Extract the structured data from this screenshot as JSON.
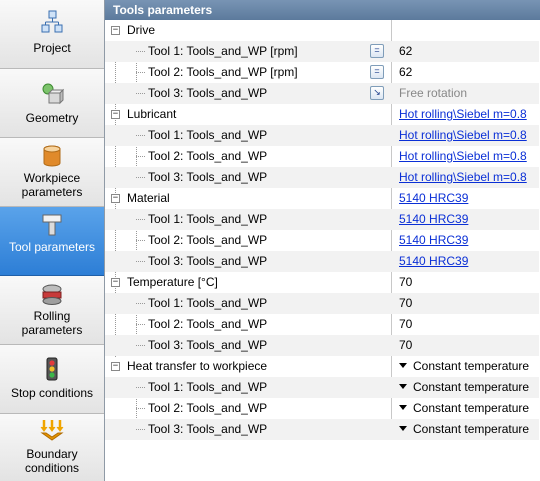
{
  "nav": [
    {
      "label": "Project",
      "icon": "project-icon"
    },
    {
      "label": "Geometry",
      "icon": "geometry-icon"
    },
    {
      "label": "Workpiece parameters",
      "icon": "workpiece-icon"
    },
    {
      "label": "Tool parameters",
      "icon": "tool-icon",
      "active": true
    },
    {
      "label": "Rolling parameters",
      "icon": "rolling-icon"
    },
    {
      "label": "Stop conditions",
      "icon": "traffic-light-icon"
    },
    {
      "label": "Boundary conditions",
      "icon": "boundary-icon"
    }
  ],
  "panel": {
    "title": "Tools parameters",
    "categories": {
      "drive": {
        "label": "Drive",
        "items": [
          {
            "label": "Tool 1: Tools_and_WP [rpm]",
            "value": "62"
          },
          {
            "label": "Tool 2: Tools_and_WP [rpm]",
            "value": "62"
          },
          {
            "label": "Tool 3: Tools_and_WP",
            "value": "Free rotation"
          }
        ]
      },
      "lubricant": {
        "label": "Lubricant",
        "value": "Hot rolling\\Siebel m=0.8",
        "items": [
          {
            "label": "Tool 1: Tools_and_WP",
            "value": "Hot rolling\\Siebel m=0.8"
          },
          {
            "label": "Tool 2: Tools_and_WP",
            "value": "Hot rolling\\Siebel m=0.8"
          },
          {
            "label": "Tool 3: Tools_and_WP",
            "value": "Hot rolling\\Siebel m=0.8"
          }
        ]
      },
      "material": {
        "label": "Material",
        "value": "5140 HRC39",
        "items": [
          {
            "label": "Tool 1: Tools_and_WP",
            "value": "5140 HRC39"
          },
          {
            "label": "Tool 2: Tools_and_WP",
            "value": "5140 HRC39"
          },
          {
            "label": "Tool 3: Tools_and_WP",
            "value": "5140 HRC39"
          }
        ]
      },
      "temperature": {
        "label": "Temperature [°C]",
        "value": "70",
        "items": [
          {
            "label": "Tool 1: Tools_and_WP",
            "value": "70"
          },
          {
            "label": "Tool 2: Tools_and_WP",
            "value": "70"
          },
          {
            "label": "Tool 3: Tools_and_WP",
            "value": "70"
          }
        ]
      },
      "heat_transfer": {
        "label": "Heat transfer to workpiece",
        "value": "Constant temperature",
        "items": [
          {
            "label": "Tool 1: Tools_and_WP",
            "value": "Constant temperature"
          },
          {
            "label": "Tool 2: Tools_and_WP",
            "value": "Constant temperature"
          },
          {
            "label": "Tool 3: Tools_and_WP",
            "value": "Constant temperature"
          }
        ]
      }
    }
  },
  "colors": {
    "active_nav": "#2d7ed6",
    "header": "#6684a6",
    "link": "#0a2fd6"
  }
}
